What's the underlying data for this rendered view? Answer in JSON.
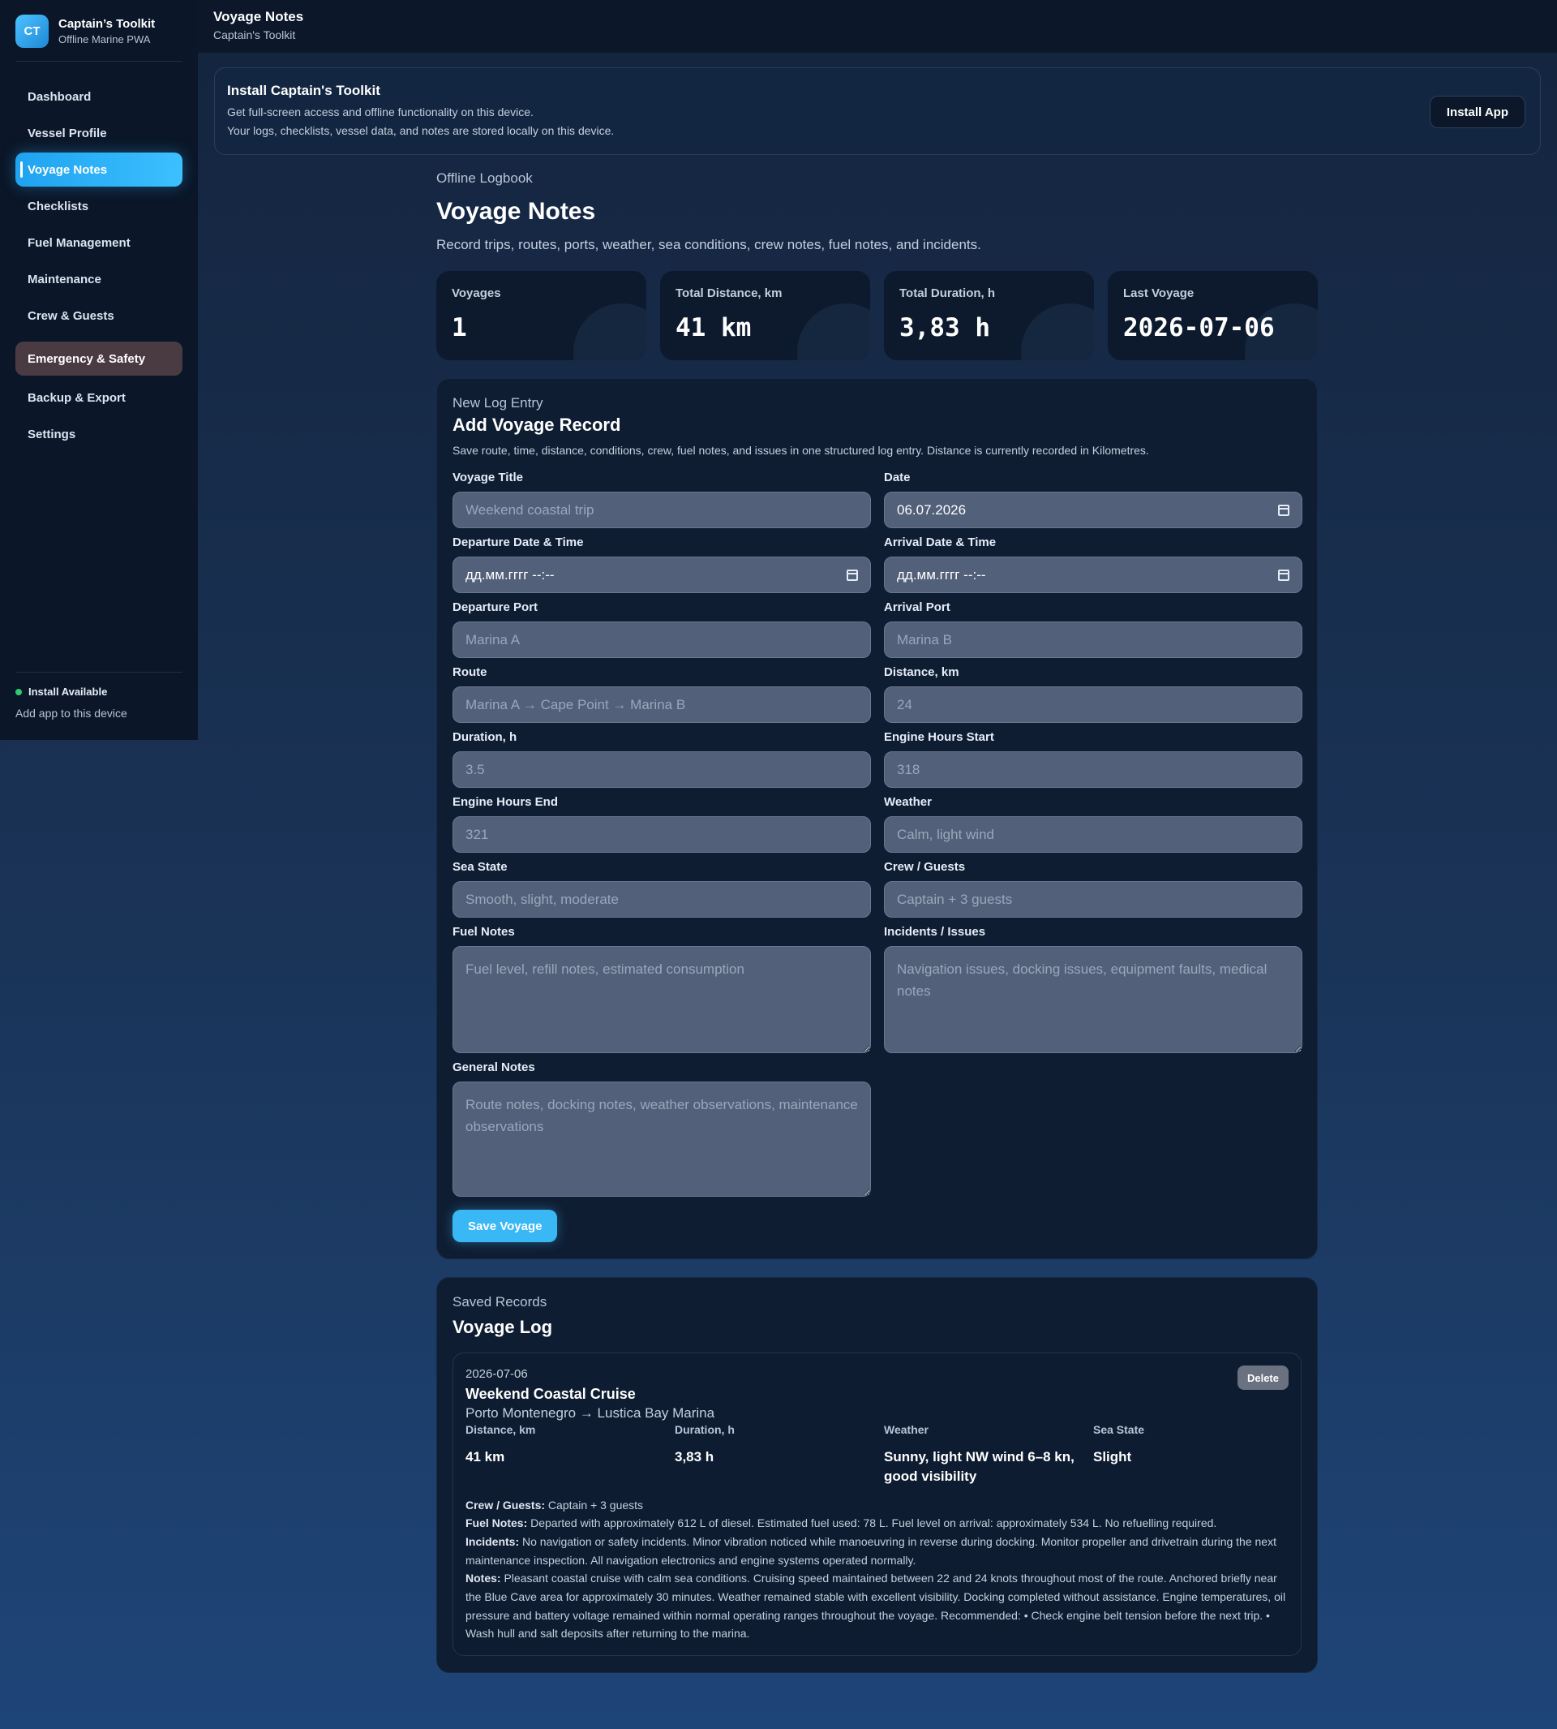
{
  "brand": {
    "logo": "CT",
    "name": "Captain’s Toolkit",
    "subtitle": "Offline Marine PWA"
  },
  "nav": {
    "items": [
      {
        "label": "Dashboard"
      },
      {
        "label": "Vessel Profile"
      },
      {
        "label": "Voyage Notes",
        "active": true
      },
      {
        "label": "Checklists"
      },
      {
        "label": "Fuel Management"
      },
      {
        "label": "Maintenance"
      },
      {
        "label": "Crew & Guests"
      },
      {
        "label": "Emergency & Safety"
      },
      {
        "label": "Backup & Export"
      },
      {
        "label": "Settings"
      }
    ]
  },
  "install_footer": {
    "status": "Install Available",
    "hint": "Add app to this device",
    "status_color": "#2ecc71"
  },
  "topbar": {
    "title": "Voyage Notes",
    "subtitle": "Captain's Toolkit"
  },
  "banner": {
    "title": "Install Captain's Toolkit",
    "line1": "Get full-screen access and offline functionality on this device.",
    "line2": "Your logs, checklists, vessel data, and notes are stored locally on this device.",
    "button": "Install App"
  },
  "header": {
    "eyebrow": "Offline Logbook",
    "title": "Voyage Notes",
    "description": "Record trips, routes, ports, weather, sea conditions, crew notes, fuel notes, and incidents."
  },
  "stats": [
    {
      "label": "Voyages",
      "value": "1"
    },
    {
      "label": "Total Distance, km",
      "value": "41 km"
    },
    {
      "label": "Total Duration, h",
      "value": "3,83 h"
    },
    {
      "label": "Last Voyage",
      "value": "2026-07-06"
    }
  ],
  "form": {
    "eyebrow": "New Log Entry",
    "title": "Add Voyage Record",
    "description": "Save route, time, distance, conditions, crew, fuel notes, and issues in one structured log entry. Distance is currently recorded in Kilometres.",
    "fields": {
      "voyage_title": {
        "label": "Voyage Title",
        "placeholder": "Weekend coastal trip"
      },
      "date": {
        "label": "Date",
        "value": "06.07.2026"
      },
      "departure": {
        "label": "Departure Date & Time",
        "value": "дд.мм.гггг --:--"
      },
      "arrival": {
        "label": "Arrival Date & Time",
        "value": "дд.мм.гггг --:--"
      },
      "departure_port": {
        "label": "Departure Port",
        "placeholder": "Marina A"
      },
      "arrival_port": {
        "label": "Arrival Port",
        "placeholder": "Marina B"
      },
      "route": {
        "label": "Route",
        "placeholder": "Marina A → Cape Point → Marina B"
      },
      "distance": {
        "label": "Distance, km",
        "placeholder": "24"
      },
      "duration": {
        "label": "Duration, h",
        "placeholder": "3.5"
      },
      "engine_start": {
        "label": "Engine Hours Start",
        "placeholder": "318"
      },
      "engine_end": {
        "label": "Engine Hours End",
        "placeholder": "321"
      },
      "weather": {
        "label": "Weather",
        "placeholder": "Calm, light wind"
      },
      "sea_state": {
        "label": "Sea State",
        "placeholder": "Smooth, slight, moderate"
      },
      "crew": {
        "label": "Crew / Guests",
        "placeholder": "Captain + 3 guests"
      },
      "fuel_notes": {
        "label": "Fuel Notes",
        "placeholder": "Fuel level, refill notes, estimated consumption"
      },
      "incidents": {
        "label": "Incidents / Issues",
        "placeholder": "Navigation issues, docking issues, equipment faults, medical notes"
      },
      "general_notes": {
        "label": "General Notes",
        "placeholder": "Route notes, docking notes, weather observations, maintenance observations"
      }
    },
    "save_button": "Save Voyage"
  },
  "log": {
    "eyebrow": "Saved Records",
    "title": "Voyage Log",
    "entry": {
      "date": "2026-07-06",
      "title": "Weekend Coastal Cruise",
      "route": "Porto Montenegro → Lustica Bay Marina",
      "delete": "Delete",
      "metrics": [
        {
          "label": "Distance, km",
          "value": "41 km"
        },
        {
          "label": "Duration, h",
          "value": "3,83 h"
        },
        {
          "label": "Weather",
          "value": "Sunny, light NW wind 6–8 kn, good visibility"
        },
        {
          "label": "Sea State",
          "value": "Slight"
        }
      ],
      "crew_label": "Crew / Guests:",
      "crew_value": "Captain + 3 guests",
      "fuel_label": "Fuel Notes:",
      "fuel_value": "Departed with approximately 612 L of diesel. Estimated fuel used: 78 L. Fuel level on arrival: approximately 534 L. No refuelling required.",
      "incidents_label": "Incidents:",
      "incidents_value": "No navigation or safety incidents. Minor vibration noticed while manoeuvring in reverse during docking. Monitor propeller and drivetrain during the next maintenance inspection. All navigation electronics and engine systems operated normally.",
      "notes_label": "Notes:",
      "notes_value": "Pleasant coastal cruise with calm sea conditions. Cruising speed maintained between 22 and 24 knots throughout most of the route. Anchored briefly near the Blue Cave area for approximately 30 minutes. Weather remained stable with excellent visibility. Docking completed without assistance. Engine temperatures, oil pressure and battery voltage remained within normal operating ranges throughout the voyage. Recommended: • Check engine belt tension before the next trip. • Wash hull and salt deposits after returning to the marina."
    }
  }
}
